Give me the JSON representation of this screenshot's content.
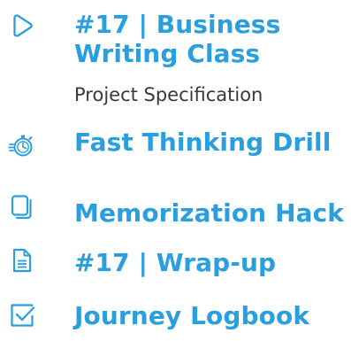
{
  "items": [
    {
      "title_line1": "#17 | Business",
      "title_line2": "Writing Class",
      "subtitle": "Project Specification",
      "icon": "play-outline-icon"
    },
    {
      "title": "Fast Thinking Drill",
      "icon": "stopwatch-icon"
    },
    {
      "title": "Memorization Hack",
      "icon": "copy-pages-icon"
    },
    {
      "title": "#17 | Wrap-up",
      "icon": "document-icon"
    },
    {
      "title": "Journey Logbook",
      "icon": "checkbox-icon"
    }
  ],
  "colors": {
    "accent": "#2a9fe0",
    "text": "#333a40"
  }
}
